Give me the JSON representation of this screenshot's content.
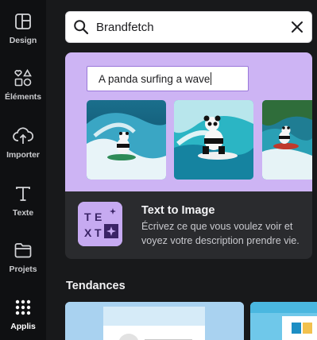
{
  "sidebar": {
    "items": [
      {
        "label": "Design",
        "icon": "layout-icon"
      },
      {
        "label": "Éléments",
        "icon": "shapes-icon"
      },
      {
        "label": "Importer",
        "icon": "cloud-upload-icon"
      },
      {
        "label": "Texte",
        "icon": "text-icon"
      },
      {
        "label": "Projets",
        "icon": "folder-icon"
      },
      {
        "label": "Applis",
        "icon": "apps-grid-icon",
        "active": true
      }
    ]
  },
  "search": {
    "value": "Brandfetch",
    "icon": "search-icon",
    "clear_icon": "close-icon"
  },
  "feature": {
    "prompt_text": "A panda surfing a wave",
    "title": "Text to Image",
    "description": "Écrivez ce que vous voulez voir et voyez votre description prendre vie.",
    "icon_letters": [
      "T",
      "E",
      "X",
      "T"
    ],
    "accent": "#cdb4f4"
  },
  "trending": {
    "title": "Tendances"
  },
  "colors": {
    "background": "#18191b",
    "rail": "#0f1012",
    "card": "#2a2b2e",
    "hero": "#cdb4f4"
  }
}
